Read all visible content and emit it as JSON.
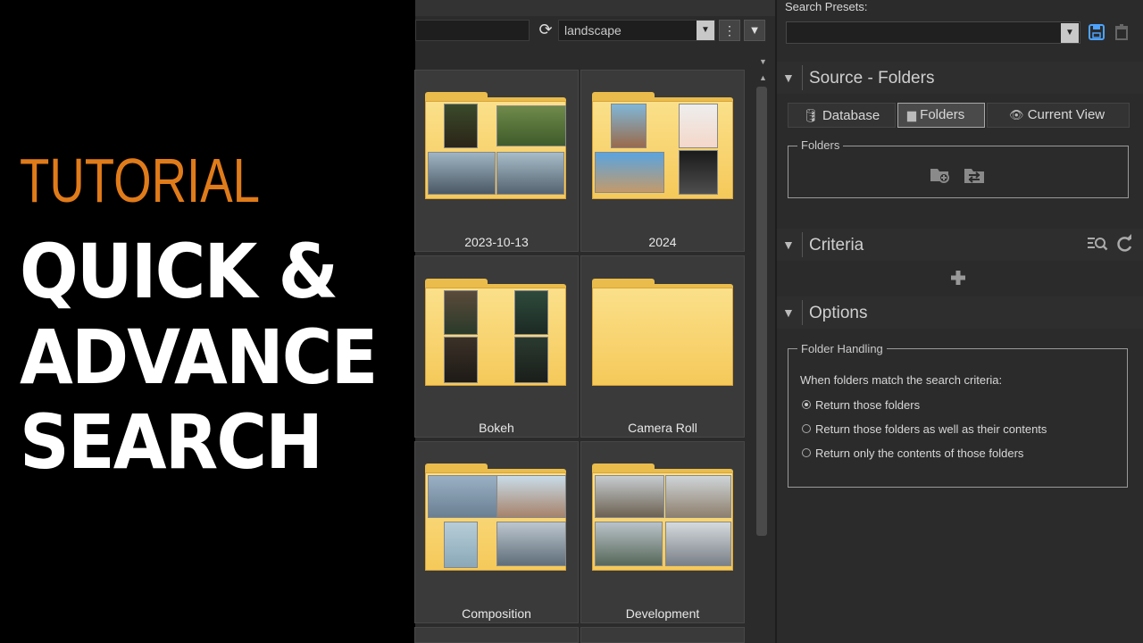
{
  "title": {
    "line1": "TUTORIAL",
    "line2": "QUICK &",
    "line3": "ADVANCE",
    "line4": "SEARCH"
  },
  "toolbar": {
    "search_value": "",
    "keyword_combo": "landscape"
  },
  "folders": [
    {
      "label": "2023-10-13"
    },
    {
      "label": "2024"
    },
    {
      "label": "Bokeh"
    },
    {
      "label": "Camera Roll"
    },
    {
      "label": "Composition"
    },
    {
      "label": "Development"
    }
  ],
  "right": {
    "search_presets_label": "Search Presets:",
    "source_title": "Source - Folders",
    "source_tabs": [
      "Database",
      "Folders",
      "Current View"
    ],
    "folders_group": "Folders",
    "criteria_title": "Criteria",
    "options_title": "Options",
    "folder_handling": "Folder Handling",
    "match_text": "When folders match the search criteria:",
    "radio_options": [
      "Return those folders",
      "Return those folders as well as their contents",
      "Return only the contents of those folders"
    ],
    "selected_option": 0
  },
  "colors": {
    "accent_orange": "#e07b1a",
    "save_icon_blue": "#4da3ff"
  }
}
